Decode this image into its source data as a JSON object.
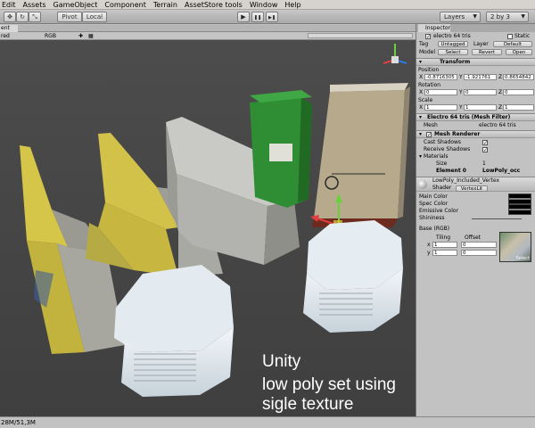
{
  "menu": [
    "Edit",
    "Assets",
    "GameObject",
    "Component",
    "Terrain",
    "AssetStore tools",
    "Window",
    "Help"
  ],
  "toolbar": {
    "pivot": "Pivot",
    "local": "Local",
    "play": "▶",
    "pause": "❚❚",
    "step": "▶❚",
    "layers": "Layers",
    "layout": "2 by 3"
  },
  "scene": {
    "tab": "ent",
    "mode": "red",
    "render": "RGB"
  },
  "viewport": {
    "caption_line1": "Unity",
    "caption_line2": "low poly set using sigle texture"
  },
  "status": {
    "text": "28M/51,3M"
  },
  "inspector": {
    "tab": "Inspector",
    "object_name": "electro 64 tris",
    "static": "Static",
    "tag_label": "Tag",
    "tag_value": "Untagged",
    "layer_label": "Layer",
    "layer_value": "Default",
    "model_label": "Model",
    "select": "Select",
    "revert": "Revert",
    "open": "Open",
    "transform": {
      "title": "Transform",
      "position_label": "Position",
      "position": {
        "x": "-0.8716305",
        "y": "-1.921761",
        "z": "0.8654842"
      },
      "rotation_label": "Rotation",
      "rotation": {
        "x": "0",
        "y": "0",
        "z": "0"
      },
      "scale_label": "Scale",
      "scale": {
        "x": "1",
        "y": "1",
        "z": "1"
      }
    },
    "mesh_filter": {
      "title": "Electro 64 tris (Mesh Filter)",
      "mesh_label": "Mesh",
      "mesh_value": "electro 64 tris"
    },
    "mesh_renderer": {
      "title": "Mesh Renderer",
      "cast_shadows": "Cast Shadows",
      "receive_shadows": "Receive Shadows",
      "materials": "Materials",
      "size_label": "Size",
      "size_value": "1",
      "element_label": "Element 0",
      "element_value": "LowPoly_occ"
    },
    "material": {
      "name": "LowPoly_Included_Vertex",
      "shader_label": "Shader",
      "shader_value": "VertexLit",
      "main_color": "Main Color",
      "spec_color": "Spec Color",
      "emissive_color": "Emissive Color",
      "shininess": "Shininess",
      "base": "Base (RGB)",
      "tiling": "Tiling",
      "offset": "Offset",
      "tiling_x": "1",
      "tiling_y": "1",
      "offset_x": "0",
      "offset_y": "0",
      "tex_select": "Select"
    }
  },
  "colors": {
    "viewport_bg": "#464646",
    "barrier_yellow": "#d4c24a",
    "barrier_grey": "#b9b9b9",
    "mailbox_green": "#2f8a2f",
    "cabinet_tan": "#b8aa8e",
    "bollard_white": "#e8eef2"
  }
}
